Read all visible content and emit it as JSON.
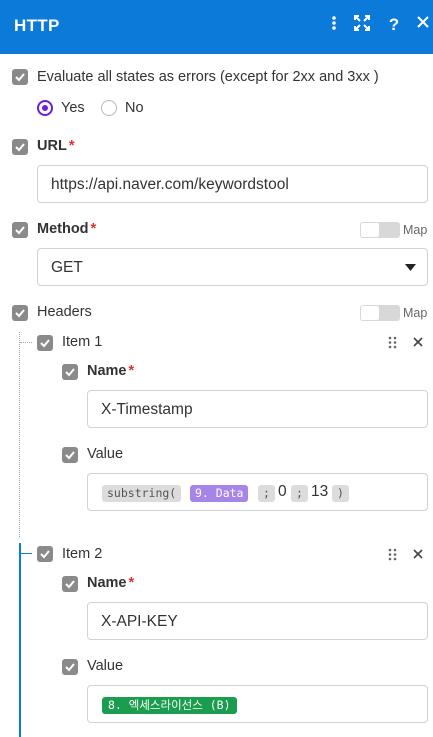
{
  "header": {
    "title": "HTTP",
    "icons": [
      "more-vertical-icon",
      "expand-icon",
      "help-icon",
      "close-icon"
    ]
  },
  "evaluate": {
    "label": "Evaluate all states as errors (except for 2xx and 3xx )",
    "options": [
      "Yes",
      "No"
    ],
    "selected": "Yes"
  },
  "url": {
    "label": "URL",
    "required_mark": "*",
    "value": "https://api.naver.com/keywordstool"
  },
  "method": {
    "label": "Method",
    "required_mark": "*",
    "value": "GET",
    "map_label": "Map"
  },
  "headers": {
    "label": "Headers",
    "map_label": "Map",
    "items": [
      {
        "title": "Item 1",
        "name_label": "Name",
        "name_required": "*",
        "name_value": "X-Timestamp",
        "value_label": "Value",
        "value_tokens": {
          "fn_open": "substring(",
          "var": "9. Data",
          "sep1": ";",
          "arg1": "0",
          "sep2": ";",
          "arg2": "13",
          "fn_close": ")"
        }
      },
      {
        "title": "Item 2",
        "name_label": "Name",
        "name_required": "*",
        "name_value": "X-API-KEY",
        "value_label": "Value",
        "value_tokens": {
          "var": "8. 엑세스라이선스 (B)"
        }
      }
    ]
  },
  "colors": {
    "header_bg": "#0b7ad8",
    "radio_accent": "#6a1fd6",
    "required": "#e03030",
    "pill_purple": "#a784e8",
    "pill_green": "#1a9d4e",
    "tree_line": "#0b7ad8"
  }
}
